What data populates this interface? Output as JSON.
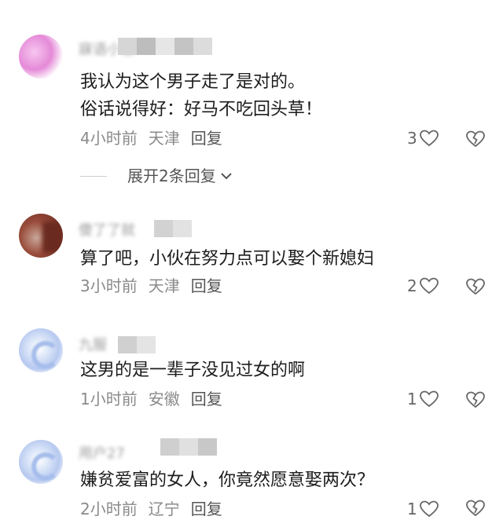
{
  "comments": [
    {
      "username": "寐语小恐",
      "text_lines": [
        "我认为这个男子走了是对的。",
        "俗话说得好：好马不吃回头草！"
      ],
      "time": "4小时前",
      "location": "天津",
      "reply_label": "回复",
      "likes": "3",
      "expand_label": "展开2条回复"
    },
    {
      "username": "傻了了就",
      "text_lines": [
        "算了吧，小伙在努力点可以娶个新媳妇"
      ],
      "time": "3小时前",
      "location": "天津",
      "reply_label": "回复",
      "likes": "2"
    },
    {
      "username": "九服",
      "text_lines": [
        "这男的是一辈子没见过女的啊"
      ],
      "time": "1小时前",
      "location": "安徽",
      "reply_label": "回复",
      "likes": "1"
    },
    {
      "username": "用户27",
      "text_lines": [
        "嫌贫爱富的女人，你竟然愿意娶两次？"
      ],
      "time": "2小时前",
      "location": "辽宁",
      "reply_label": "回复",
      "likes": "1"
    }
  ],
  "icons": {
    "like": "heart-outline-icon",
    "dislike": "broken-heart-icon",
    "expand": "chevron-down-icon"
  },
  "colors": {
    "meta_text": "#8a8a8a",
    "body_text": "#1c1c1c",
    "icon_stroke": "#666666"
  }
}
